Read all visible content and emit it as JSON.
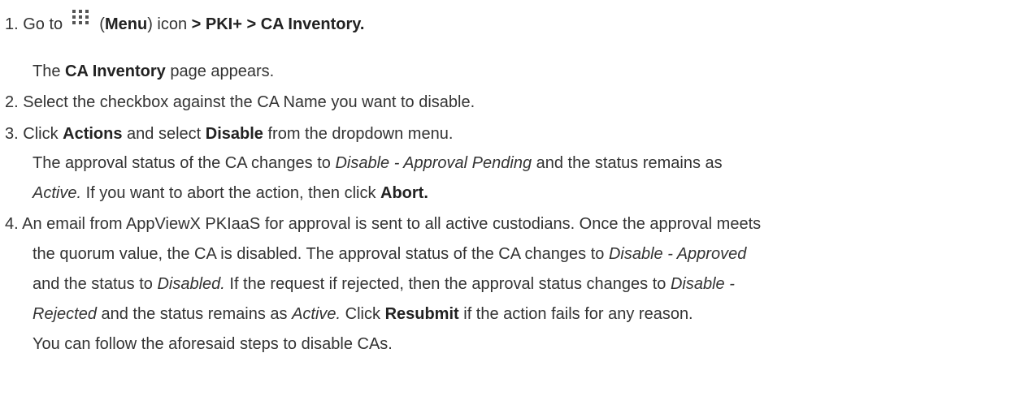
{
  "steps": [
    {
      "number": "1.",
      "t1": "Go to",
      "icon": "grid-menu-icon",
      "t2": "(",
      "b1": "Menu",
      "t3": ") icon",
      "b2": " > PKI+ > CA Inventory.",
      "note_t1": "The ",
      "note_b1": "CA Inventory",
      "note_t2": " page appears."
    },
    {
      "number": "2.",
      "text": "Select the checkbox against the CA Name you want to disable."
    },
    {
      "number": "3.",
      "t1": "Click ",
      "b1": "Actions",
      "t2": " and select ",
      "b2": "Disable",
      "t3": " from the dropdown menu.",
      "note1_t1": "The approval status of the CA changes to ",
      "note1_i1": "Disable - Approval Pending",
      "note1_t2": " and the status remains as",
      "note2_i1": "Active.",
      "note2_t1": " If you want to abort the action, then click ",
      "note2_b1": "Abort."
    },
    {
      "number": "4.",
      "l1": "An email from AppViewX PKIaaS for approval is sent to all active custodians. Once the approval meets",
      "l2_t1": "the quorum value, the CA is disabled. The approval status of the CA changes to ",
      "l2_i1": "Disable - Approved",
      "l3_t1": "and the status to ",
      "l3_i1": "Disabled.",
      "l3_t2": " If the request if rejected, then the approval status changes to ",
      "l3_i2": "Disable -",
      "l4_i1": "Rejected",
      "l4_t1": " and the status remains as ",
      "l4_i2": "Active.",
      "l4_t2": " Click ",
      "l4_b1": "Resubmit",
      "l4_t3": " if the action fails for any reason.",
      "l5": "You can follow the aforesaid steps to disable CAs."
    }
  ]
}
